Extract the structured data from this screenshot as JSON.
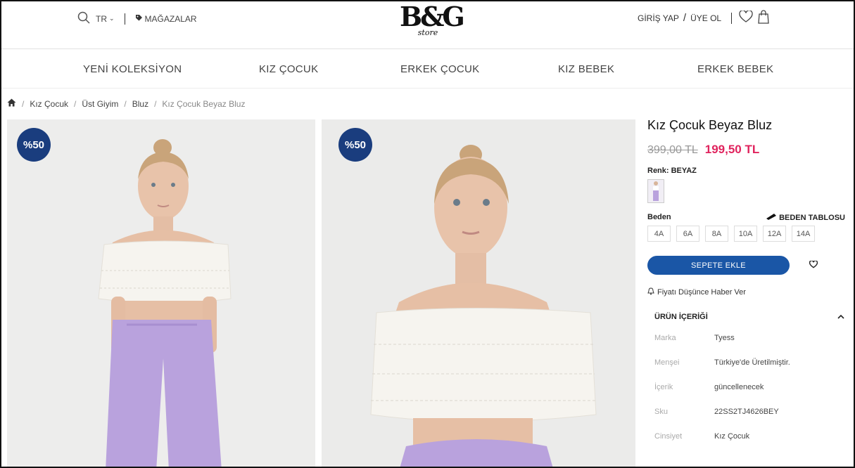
{
  "header": {
    "language": "TR",
    "stores": "MAĞAZALAR",
    "logo_main": "B&G",
    "logo_sub": "store",
    "login": "GİRİŞ YAP",
    "slash": "/",
    "register": "ÜYE OL"
  },
  "nav": [
    "YENİ KOLEKSİYON",
    "KIZ ÇOCUK",
    "ERKEK ÇOCUK",
    "KIZ BEBEK",
    "ERKEK BEBEK"
  ],
  "breadcrumb": [
    "Kız Çocuk",
    "Üst Giyim",
    "Bluz",
    "Kız Çocuk Beyaz Bluz"
  ],
  "images": [
    {
      "badge": "%50"
    },
    {
      "badge": "%50"
    }
  ],
  "product": {
    "title": "Kız Çocuk Beyaz Bluz",
    "old_price": "399,00 TL",
    "new_price": "199,50 TL",
    "color_label": "Renk: BEYAZ",
    "size_label": "Beden",
    "size_table": "BEDEN TABLOSU",
    "sizes": [
      "4A",
      "6A",
      "8A",
      "10A",
      "12A",
      "14A"
    ],
    "add_to_cart": "SEPETE EKLE",
    "notify": "Fiyatı Düşünce Haber Ver",
    "content_title": "ÜRÜN İÇERİĞİ",
    "specs": [
      {
        "k": "Marka",
        "v": "Tyess"
      },
      {
        "k": "Menşei",
        "v": "Türkiye'de Üretilmiştir."
      },
      {
        "k": "İçerik",
        "v": "güncellenecek"
      },
      {
        "k": "Sku",
        "v": "22SS2TJ4626BEY"
      },
      {
        "k": "Cinsiyet",
        "v": "Kız Çocuk"
      }
    ]
  },
  "colors": {
    "accent": "#1a56a6",
    "badge": "#1a3d7e",
    "sale_price": "#e0245e"
  }
}
